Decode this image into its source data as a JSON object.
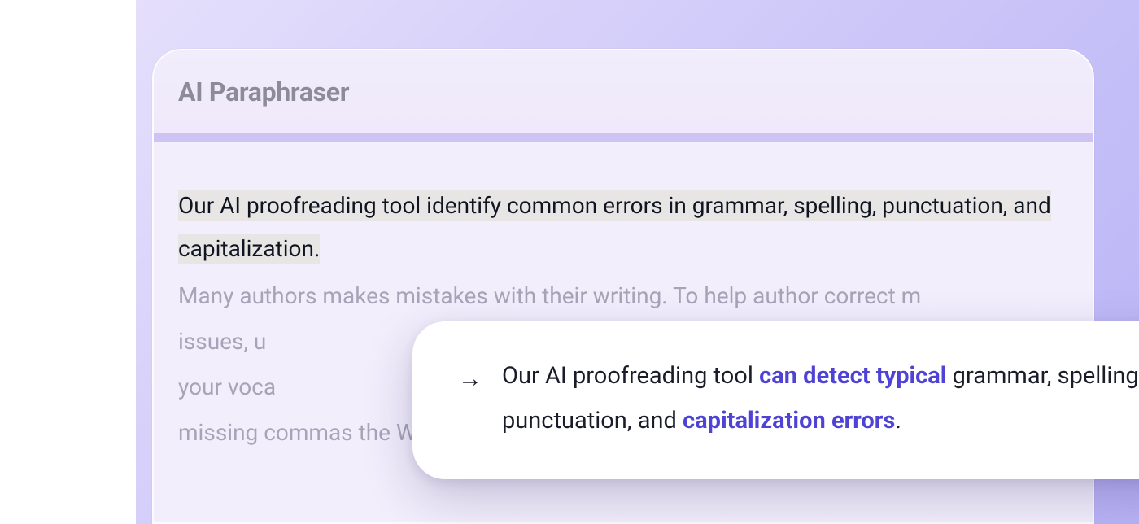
{
  "window": {
    "title": "AI Paraphraser"
  },
  "editor": {
    "highlighted_text": "Our AI proofreading tool identify common errors in grammar, spelling, punctuation, and capitalization.",
    "following_text": " Many authors makes mistakes with their writing. To help author correct m\nissues, u\nyour voca\nmissing commas the Wordvice AI Proofreader will fix this issue"
  },
  "suggestion": {
    "arrow": "→",
    "prefix": "Our AI proofreading tool ",
    "change1": "can detect typical",
    "middle": " grammar, spelling, punctuation, and ",
    "change2": "capitalization errors",
    "suffix": "."
  }
}
